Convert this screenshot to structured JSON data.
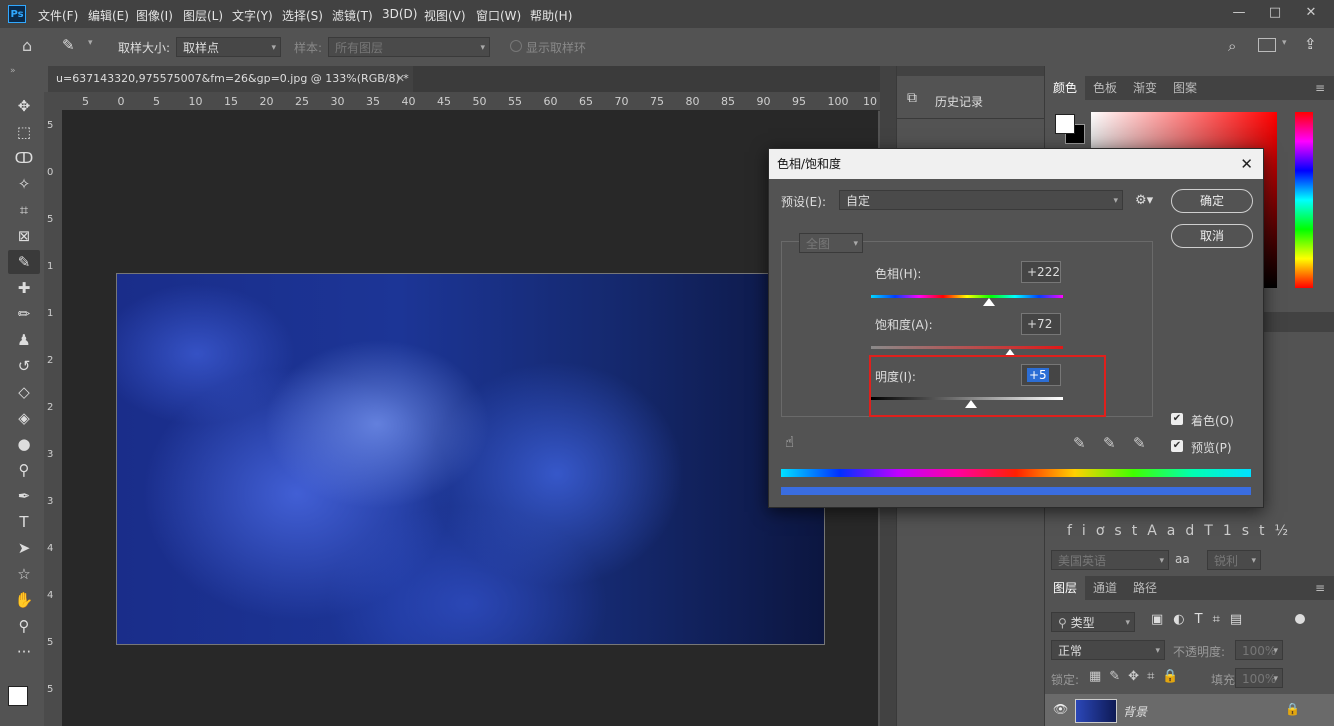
{
  "menubar": {
    "logo": "Ps",
    "items": [
      "文件(F)",
      "编辑(E)",
      "图像(I)",
      "图层(L)",
      "文字(Y)",
      "选择(S)",
      "滤镜(T)",
      "3D(D)",
      "视图(V)",
      "窗口(W)",
      "帮助(H)"
    ]
  },
  "options": {
    "sample_size_label": "取样大小:",
    "sample_size_value": "取样点",
    "sample_label": "样本:",
    "sample_value": "所有图层",
    "show_ring_label": "显示取样环"
  },
  "document": {
    "tab_title": "u=637143320,975575007&fm=26&gp=0.jpg @ 133%(RGB/8) *",
    "ruler_h": [
      "5",
      "0",
      "5",
      "10",
      "15",
      "20",
      "25",
      "30",
      "35",
      "40",
      "45",
      "50",
      "55",
      "60",
      "65",
      "70",
      "75",
      "80",
      "85",
      "90",
      "95",
      "100",
      "10"
    ],
    "ruler_v": [
      "5",
      "0",
      "5",
      "1",
      "1",
      "2",
      "2",
      "3",
      "3",
      "4",
      "4",
      "5",
      "5"
    ]
  },
  "history_panel": {
    "title": "历史记录"
  },
  "color_panel": {
    "tabs": [
      "颜色",
      "色板",
      "渐变",
      "图案"
    ]
  },
  "char_panel": {
    "language": "美国英语",
    "aa_label": "aa",
    "aa_value": "锐利",
    "glyphs": [
      "fi",
      "ơ",
      "st",
      "A",
      "ad",
      "T",
      "1st",
      "½"
    ]
  },
  "layers_panel": {
    "tabs": [
      "图层",
      "通道",
      "路径"
    ],
    "filter": "类型",
    "blend_mode": "正常",
    "opacity_label": "不透明度:",
    "opacity_value": "100%",
    "lock_label": "锁定:",
    "fill_label": "填充:",
    "fill_value": "100%",
    "layer_name": "背景"
  },
  "dialog": {
    "title": "色相/饱和度",
    "preset_label": "预设(E):",
    "preset_value": "自定",
    "channel": "全图",
    "ok": "确定",
    "cancel": "取消",
    "hue_label": "色相(H):",
    "hue_value": "+222",
    "sat_label": "饱和度(A):",
    "sat_value": "+72",
    "light_label": "明度(I):",
    "light_value": "+5",
    "colorize_label": "着色(O)",
    "preview_label": "预览(P)",
    "colorize_checked": true,
    "preview_checked": true
  },
  "colors": {
    "highlight": "#e0201c",
    "accent": "#3a6de0"
  }
}
